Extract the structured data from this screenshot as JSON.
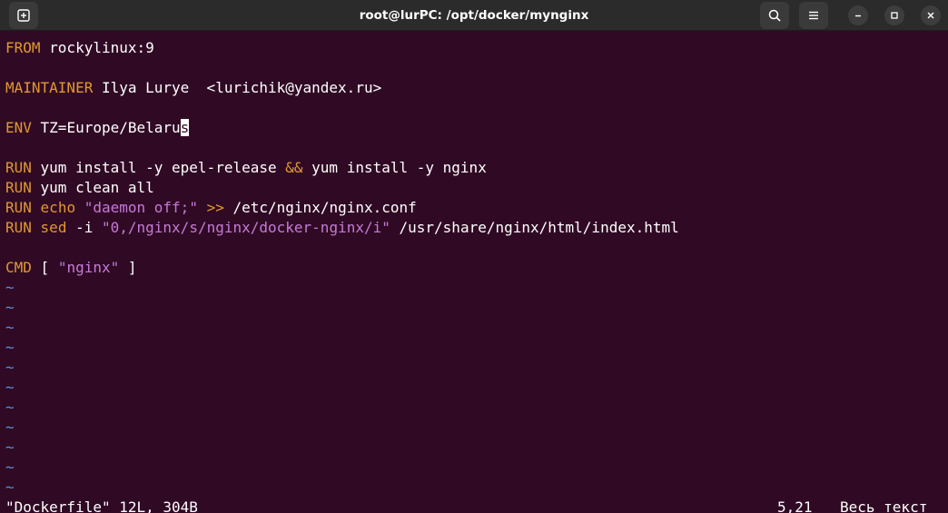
{
  "window": {
    "title": "root@lurPC: /opt/docker/mynginx"
  },
  "header": {
    "new_tab_icon": "new-tab-icon",
    "search_icon": "search-icon",
    "menu_icon": "hamburger-menu-icon"
  },
  "editor": {
    "lines": [
      {
        "kw": "FROM",
        "rest": " rockylinux:9"
      },
      {
        "kw": "MAINTAINER",
        "rest": " Ilya Lurye  <lurichik@yandex.ru>"
      },
      {
        "kw": "ENV",
        "rest": " TZ=Europe/Belaru",
        "cursor_char": "s"
      },
      {
        "kw": "RUN",
        "a": " yum install -y epel-release ",
        "op": "&&",
        "b": " yum install -y nginx"
      },
      {
        "kw": "RUN",
        "rest": " yum clean all"
      },
      {
        "kw": "RUN",
        "a": " ",
        "kw2": "echo",
        "b": " ",
        "str": "\"daemon off;\"",
        "c": " ",
        "op": ">>",
        "d": " /etc/nginx/nginx.conf"
      },
      {
        "kw": "RUN",
        "a": " ",
        "kw2": "sed",
        "b": " -i ",
        "str": "\"0,/nginx/s/nginx/docker-nginx/i\"",
        "c": " /usr/share/nginx/html/index.html"
      },
      {
        "kw": "CMD",
        "a": " [ ",
        "str": "\"nginx\"",
        "b": " ]"
      }
    ],
    "tilde": "~"
  },
  "status_bar": {
    "file_info": "\"Dockerfile\" 12L, 304B",
    "cursor_position": "5,21",
    "scroll_position": "Весь текст"
  },
  "colors": {
    "background": "#300a24",
    "keyword": "#e09830",
    "string": "#c57ad8",
    "tilde": "#5c8fd6",
    "text": "#ffffff"
  }
}
